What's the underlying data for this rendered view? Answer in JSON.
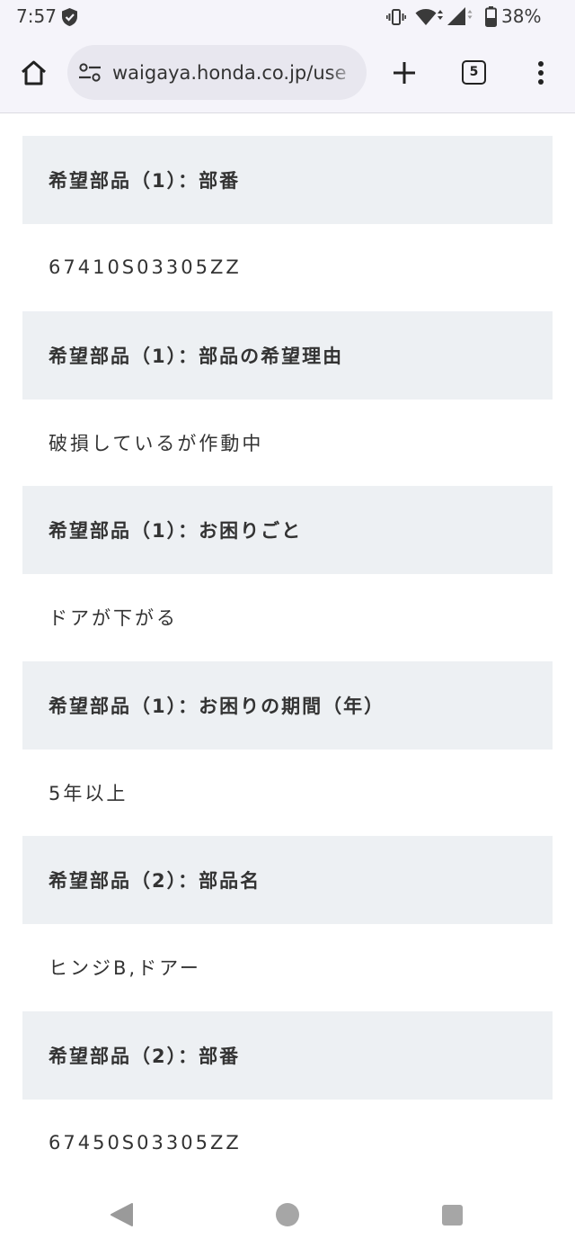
{
  "status_bar": {
    "time": "7:57",
    "battery_text": "38%",
    "battery_level": 0.38,
    "left_icons": [
      "shield-check-icon"
    ],
    "right_icons": [
      "vibrate-icon",
      "wifi-icon",
      "cell-signal-icon",
      "battery-icon"
    ]
  },
  "browser": {
    "url": "waigaya.honda.co.jp/use",
    "tab_count": "5",
    "icons": [
      "home-icon",
      "site-settings-tune-icon",
      "new-tab-plus-icon",
      "tab-switcher-icon",
      "more-menu-icon"
    ]
  },
  "fields": [
    {
      "label": "希望部品（1）：部番",
      "value": "67410S03305ZZ"
    },
    {
      "label": "希望部品（1）：部品の希望理由",
      "value": "破損しているが作動中"
    },
    {
      "label": "希望部品（1）：お困りごと",
      "value": "ドアが下がる"
    },
    {
      "label": "希望部品（1）：お困りの期間（年）",
      "value": "5年以上"
    },
    {
      "label": "希望部品（2）：部品名",
      "value": "ヒンジB,ドアー"
    },
    {
      "label": "希望部品（2）：部番",
      "value": "67450S03305ZZ"
    }
  ],
  "nav_bar": {
    "icons": [
      "back-icon",
      "home-circle-icon",
      "recents-square-icon"
    ]
  },
  "colors": {
    "chrome_bg": "#f5f4fa",
    "omnibox_bg": "#e8e7ef",
    "label_bg": "#edf0f3",
    "text": "#333333",
    "nav_icon": "#9a9a9a"
  }
}
